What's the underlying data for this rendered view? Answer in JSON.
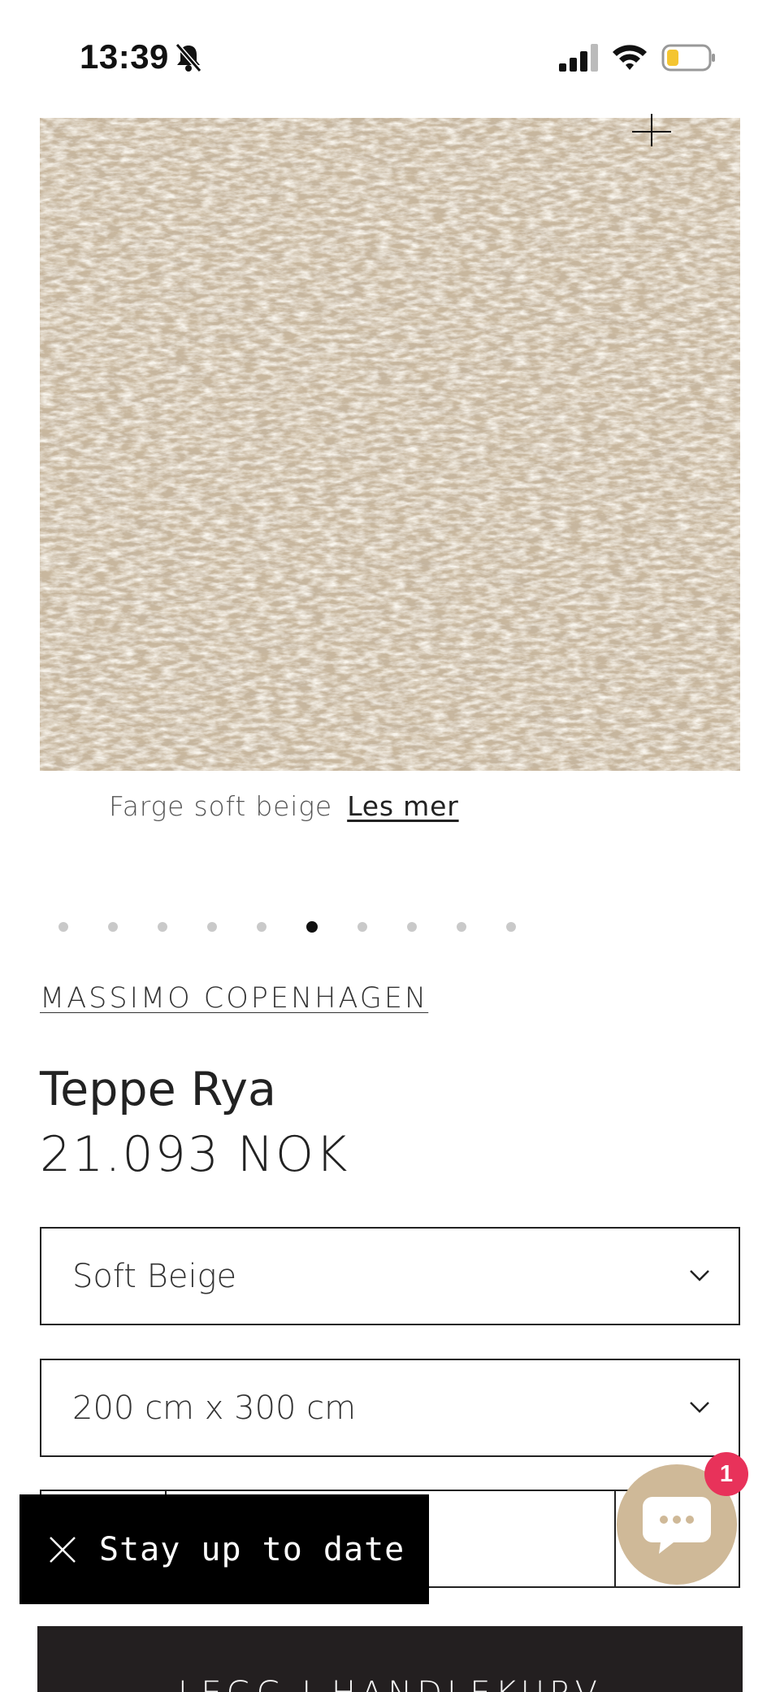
{
  "status_bar": {
    "time": "13:39",
    "icons": [
      "bell-slash-icon",
      "cellular-signal-icon",
      "wifi-icon",
      "battery-low-icon"
    ]
  },
  "gallery": {
    "image_alt": "Shaggy rya rug close-up, soft beige",
    "zoom_icon": "zoom-plus-icon",
    "caption_text": "Farge soft beige",
    "caption_link": "Les mer",
    "dot_count": 10,
    "active_dot": 5
  },
  "product": {
    "vendor": "MASSIMO COPENHAGEN",
    "title": "Teppe Rya",
    "price": "21.093 NOK"
  },
  "options": {
    "color_selected": "Soft Beige",
    "size_selected": "200 cm x 300 cm"
  },
  "newsletter": {
    "label": "Stay up to date",
    "close_icon": "close-icon"
  },
  "chat": {
    "icon": "chat-bubble-icon",
    "badge_count": "1"
  },
  "cart": {
    "button_label": "LEGG I HANDLEKURV"
  },
  "colors": {
    "accent": "#cfb998",
    "badge": "#e8325a",
    "button_bg": "#231f20"
  }
}
